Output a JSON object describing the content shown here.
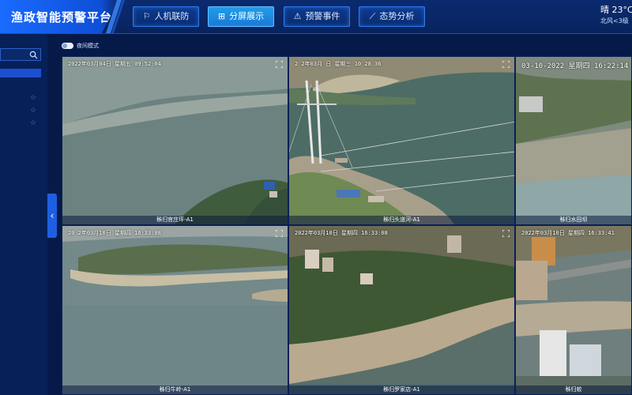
{
  "app": {
    "title": "渔政智能预警平台"
  },
  "nav": {
    "tabs": [
      {
        "label": "人机联防",
        "icon": "flag-icon",
        "active": false
      },
      {
        "label": "分屏展示",
        "icon": "grid-icon",
        "active": true
      },
      {
        "label": "预警事件",
        "icon": "alert-icon",
        "active": false
      },
      {
        "label": "态势分析",
        "icon": "trend-icon",
        "active": false
      }
    ]
  },
  "weather": {
    "condition_temp": "晴 23°C",
    "wind": "北风<3级"
  },
  "sidebar": {
    "search": {
      "value": "",
      "placeholder": ""
    },
    "collapse_icon": "chevron-left-icon"
  },
  "toolbar": {
    "night_mode_label": "夜间模式",
    "night_mode_on": false
  },
  "cameras": [
    {
      "timestamp": "2022年03月04日  星期五  09:52:04",
      "name": "秭归官庄坪-A1"
    },
    {
      "timestamp": "2 2年03月  日  星期三  10 28 36",
      "name": "秭归头道河-A1"
    },
    {
      "timestamp": "03-10-2022  星期四  16:22:14",
      "name": "秭归水田坝"
    },
    {
      "timestamp": "20 2年03月10日  星期四  16:33:08",
      "name": "秭归牛岭-A1"
    },
    {
      "timestamp": "2022年03月10日  星期四  16:33:08",
      "name": "秭归罗家店-A1"
    },
    {
      "timestamp": "2022年03月10日  星期四  16:33:41",
      "name": "秭归蛟"
    }
  ]
}
